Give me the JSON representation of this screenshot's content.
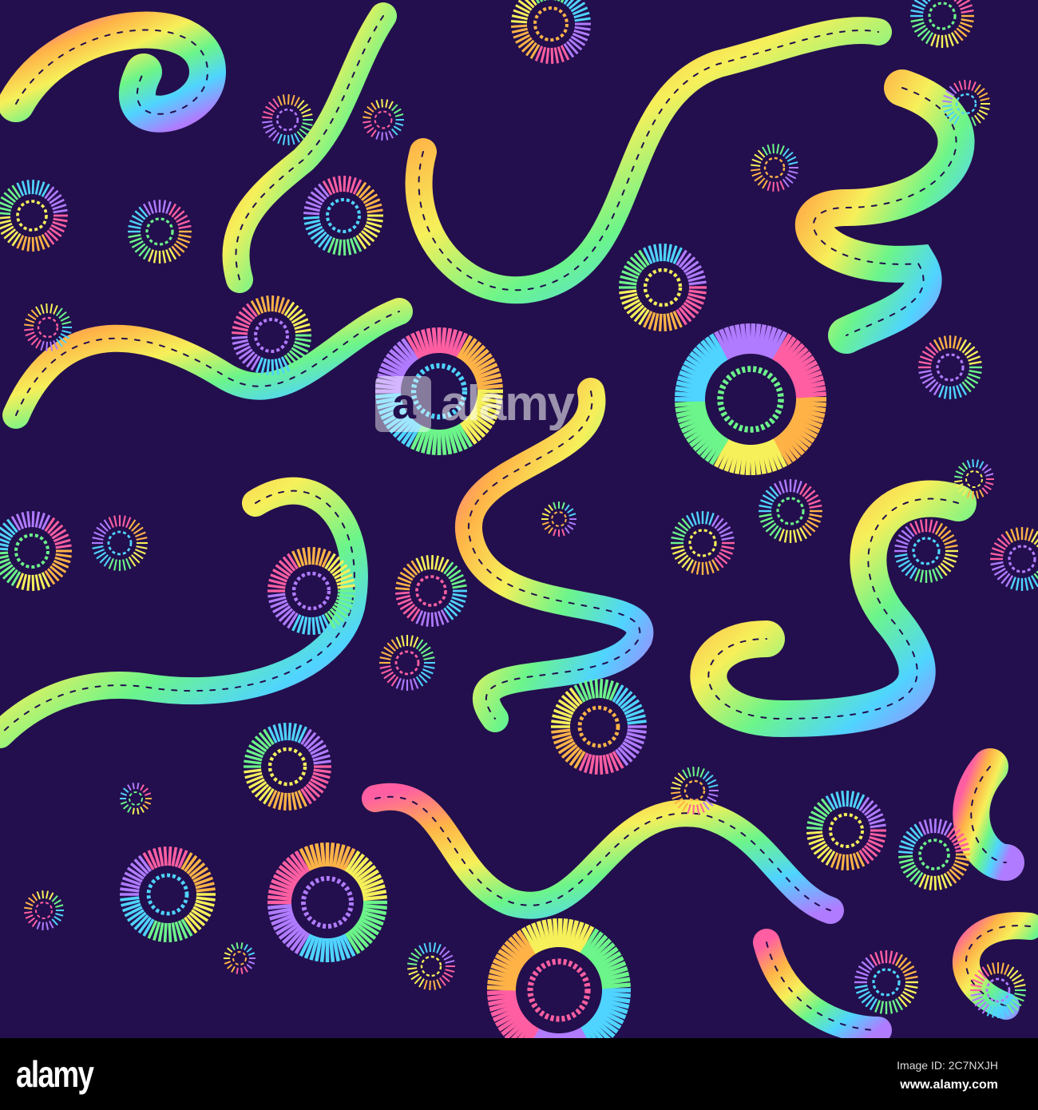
{
  "watermark": {
    "logo_letter": "a",
    "text": "alamy"
  },
  "footer": {
    "brand": "alamy",
    "image_id": "Image ID: 2C7NXJH",
    "site": "www.alamy.com"
  },
  "colors": {
    "background": "#230f4d",
    "rainbow": [
      "#ff5fa2",
      "#ffb347",
      "#f6f05a",
      "#6cf58a",
      "#4fd4ff",
      "#b07bff"
    ]
  }
}
